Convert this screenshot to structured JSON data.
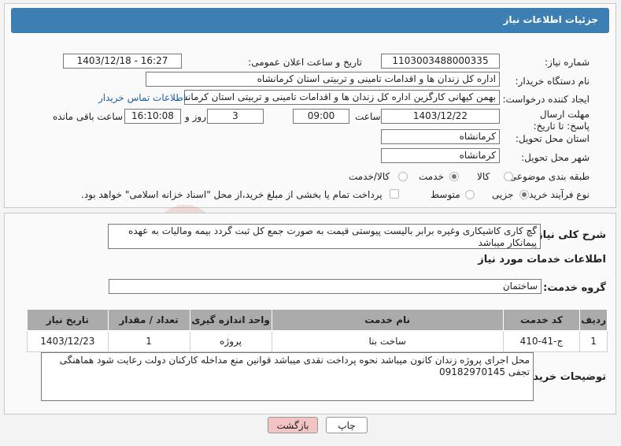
{
  "header": {
    "title": "جزئیات اطلاعات نیاز"
  },
  "fields": {
    "need_number_label": "شماره نیاز:",
    "need_number": "1103003488000335",
    "announce_label": "تاریخ و ساعت اعلان عمومی:",
    "announce_value": "1403/12/18 - 16:27",
    "buyer_org_label": "نام دستگاه خریدار:",
    "buyer_org": "اداره کل زندان ها و اقدامات تامینی و تربیتی استان کرمانشاه",
    "requester_label": "ایجاد کننده درخواست:",
    "requester": "بهمن کیهانی کارگزین اداره کل زندان ها و اقدامات تامینی و تربیتی استان کرمانشاه",
    "contact_link": "اطلاعات تماس خریدار",
    "deadline_label": "مهلت ارسال پاسخ: تا تاریخ:",
    "deadline_date": "1403/12/22",
    "time_label": "ساعت",
    "deadline_time": "09:00",
    "days_value": "3",
    "days_label": "روز و",
    "remaining_time": "16:10:08",
    "remaining_label": "ساعت باقی مانده",
    "province_label": "استان محل تحویل:",
    "province": "کرمانشاه",
    "city_label": "شهر محل تحویل:",
    "city": "کرمانشاه",
    "category_label": "طبقه بندی موضوعی:",
    "category_options": [
      "کالا",
      "خدمت",
      "کالا/خدمت"
    ],
    "process_label": "نوع فرآیند خرید :",
    "process_options": [
      "جزیی",
      "متوسط"
    ],
    "payment_note": "پرداخت تمام یا بخشی از مبلغ خرید،از محل \"اسناد خزانه اسلامی\" خواهد بود."
  },
  "description": {
    "label": "شرح کلی نیاز:",
    "text": "گچ کاری کاشیکاری وغیره برابر بالیست پیوستی قیمت به صورت جمع کل ثبت گردد بیمه ومالیات به عهده پیمانکار میباشد"
  },
  "services": {
    "section_title": "اطلاعات خدمات مورد نیاز",
    "group_label": "گروه خدمت:",
    "group_value": "ساختمان",
    "columns": [
      "ردیف",
      "کد خدمت",
      "نام خدمت",
      "واحد اندازه گیری",
      "تعداد / مقدار",
      "تاریخ نیاز"
    ],
    "rows": [
      [
        "1",
        "ج-41-410",
        "ساخت بنا",
        "پروژه",
        "1",
        "1403/12/23"
      ]
    ]
  },
  "buyer_notes": {
    "label": "توضیحات خریدار:",
    "text": "محل اجرای پروژه زندان کانون میباشد نحوه پرداخت  نقدی میباشد قوانین منع مداخله کارکنان دولت رعایت شود هماهنگی تجفی 09182970145"
  },
  "buttons": {
    "print": "چاپ",
    "back": "بازگشت"
  },
  "watermark": "AriaTender.neT",
  "colors": {
    "header_bg": "#3d7fb3",
    "link": "#1f5fa0",
    "back_btn": "#f2c4c4"
  }
}
